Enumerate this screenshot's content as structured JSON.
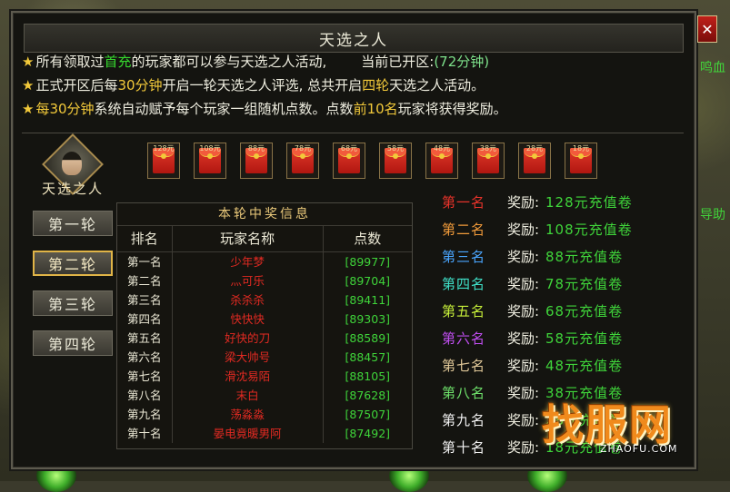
{
  "window": {
    "title": "天选之人",
    "close_label": "✕"
  },
  "notes": {
    "line1": {
      "p1": "所有领取过",
      "h1": "首充",
      "p2": "的玩家都可以参与天选之人活动,",
      "p3": "当前已开区:",
      "h2": "(72分钟)"
    },
    "line2": {
      "p1": "正式开区后每",
      "h1": "30分钟",
      "p2": "开启一轮天选之人评选, 总共开启",
      "h2": "四轮",
      "p3": "天选之人活动。"
    },
    "line3": {
      "h1": "每30分钟",
      "p1": "系统自动赋予每个玩家一组随机点数。点数",
      "h2": "前10名",
      "p2": "玩家将获得奖励。"
    }
  },
  "avatar": {
    "label": "天选之人"
  },
  "reward_icons": [
    "128元",
    "108元",
    "88元",
    "78元",
    "68元",
    "58元",
    "48元",
    "38元",
    "28元",
    "18元"
  ],
  "rounds": [
    {
      "label": "第一轮",
      "active": false
    },
    {
      "label": "第二轮",
      "active": true
    },
    {
      "label": "第三轮",
      "active": false
    },
    {
      "label": "第四轮",
      "active": false
    }
  ],
  "winners": {
    "title": "本轮中奖信息",
    "headers": {
      "rank": "排名",
      "player": "玩家名称",
      "points": "点数"
    },
    "rows": [
      {
        "rank": "第一名",
        "player": "少年梦",
        "points": "[89977]"
      },
      {
        "rank": "第二名",
        "player": "灬可乐",
        "points": "[89704]"
      },
      {
        "rank": "第三名",
        "player": "杀杀杀",
        "points": "[89411]"
      },
      {
        "rank": "第四名",
        "player": "快快快",
        "points": "[89303]"
      },
      {
        "rank": "第五名",
        "player": "好快的刀",
        "points": "[88589]"
      },
      {
        "rank": "第六名",
        "player": "梁大帅号",
        "points": "[88457]"
      },
      {
        "rank": "第七名",
        "player": "滑沈易陌",
        "points": "[88105]"
      },
      {
        "rank": "第八名",
        "player": "末白",
        "points": "[87628]"
      },
      {
        "rank": "第九名",
        "player": "荡淼淼",
        "points": "[87507]"
      },
      {
        "rank": "第十名",
        "player": "晏电竟暖男阿",
        "points": "[87492]"
      }
    ]
  },
  "prizes": [
    {
      "rank": "第一名",
      "label": "奖励:",
      "value": "128元充值卷",
      "color": "#e8332a"
    },
    {
      "rank": "第二名",
      "label": "奖励:",
      "value": "108元充值卷",
      "color": "#f09a3a"
    },
    {
      "rank": "第三名",
      "label": "奖励:",
      "value": "88元充值卷",
      "color": "#4aa6ff"
    },
    {
      "rank": "第四名",
      "label": "奖励:",
      "value": "78元充值卷",
      "color": "#3fe0c8"
    },
    {
      "rank": "第五名",
      "label": "奖励:",
      "value": "68元充值卷",
      "color": "#c7ef3a"
    },
    {
      "rank": "第六名",
      "label": "奖励:",
      "value": "58元充值卷",
      "color": "#c04ef0"
    },
    {
      "rank": "第七名",
      "label": "奖励:",
      "value": "48元充值卷",
      "color": "#e0c898"
    },
    {
      "rank": "第八名",
      "label": "奖励:",
      "value": "38元充值卷",
      "color": "#6ee06a"
    },
    {
      "rank": "第九名",
      "label": "奖励:",
      "value": "28元充值卷",
      "color": "#f2f2f2"
    },
    {
      "rank": "第十名",
      "label": "奖励:",
      "value": "18元充值卷",
      "color": "#f2f2f2"
    }
  ],
  "watermark": {
    "text": "找服网",
    "sub": "ZHAOFU.COM"
  },
  "background": {
    "side_text_1": "鸣血",
    "side_text_2": "导助"
  }
}
